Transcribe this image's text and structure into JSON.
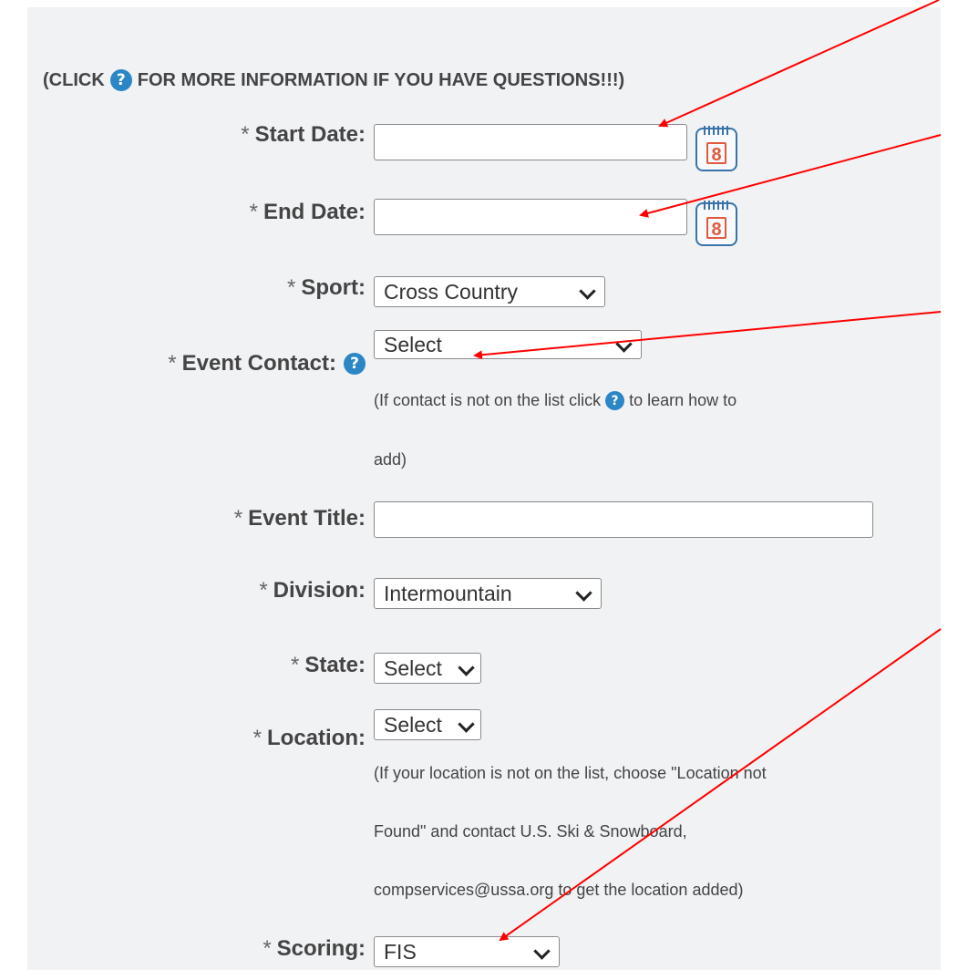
{
  "form": {
    "instruction_prefix": "(CLICK",
    "instruction_suffix": "FOR MORE INFORMATION IF YOU HAVE QUESTIONS!!!)",
    "help_glyph": "?",
    "required_mark": "*",
    "fields": {
      "start_date": {
        "label": "Start Date:",
        "value": ""
      },
      "end_date": {
        "label": "End Date:",
        "value": ""
      },
      "calendar_day": "8",
      "sport": {
        "label": "Sport:",
        "selected": "Cross Country"
      },
      "event_contact": {
        "label": "Event Contact:",
        "selected": "Select",
        "note_prefix": "(If contact is not on the list click",
        "note_suffix": "to learn how to",
        "note_line2": "add)"
      },
      "event_title": {
        "label": "Event Title:",
        "value": ""
      },
      "division": {
        "label": "Division:",
        "selected": "Intermountain"
      },
      "state": {
        "label": "State:",
        "selected": "Select"
      },
      "location": {
        "label": "Location:",
        "selected": "Select",
        "note_lines": [
          "(If your location is not on the list, choose \"Location not",
          "Found\" and contact U.S. Ski & Snowboard,",
          "compservices@ussa.org to get the location added)"
        ]
      },
      "scoring": {
        "label": "Scoring:",
        "selected": "FIS"
      }
    }
  },
  "annotation": {
    "arrow_color": "#ff0000"
  }
}
